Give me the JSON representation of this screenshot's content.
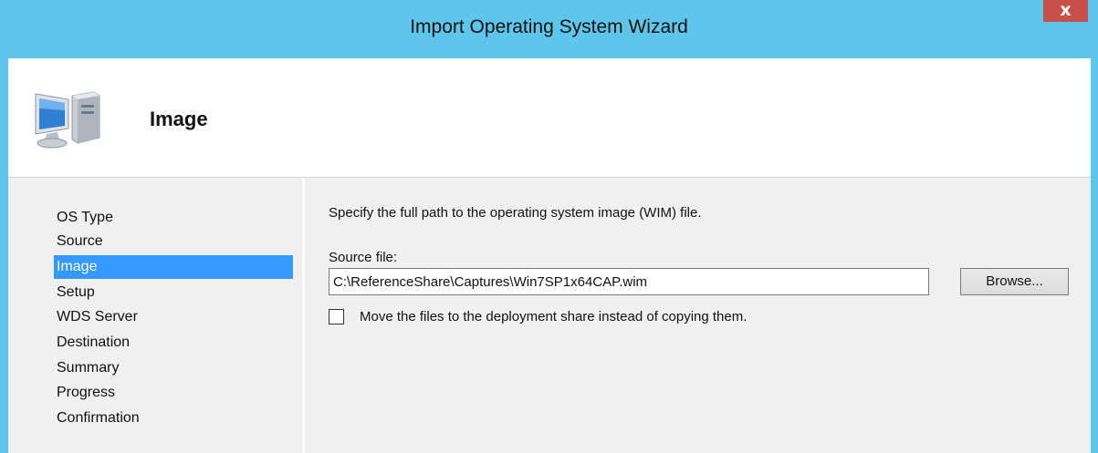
{
  "window": {
    "title": "Import Operating System Wizard",
    "close_glyph": "x",
    "colors": {
      "title_bar": "#5ec6ea",
      "close_button": "#c7504b",
      "selection": "#3399ff"
    }
  },
  "header": {
    "icon": "computer-icon",
    "title": "Image"
  },
  "nav": {
    "items": [
      {
        "label": "OS Type",
        "active": false
      },
      {
        "label": "Source",
        "active": false
      },
      {
        "label": "Image",
        "active": true
      },
      {
        "label": "Setup",
        "active": false
      },
      {
        "label": "WDS Server",
        "active": false
      },
      {
        "label": "Destination",
        "active": false
      },
      {
        "label": "Summary",
        "active": false
      },
      {
        "label": "Progress",
        "active": false
      },
      {
        "label": "Confirmation",
        "active": false
      }
    ]
  },
  "content": {
    "instruction": "Specify the full path to the operating system image (WIM) file.",
    "source_label": "Source file:",
    "source_value": "C:\\ReferenceShare\\Captures\\Win7SP1x64CAP.wim",
    "browse_label": "Browse...",
    "move_label": "Move the files to the deployment share instead of copying them.",
    "move_checked": false
  }
}
